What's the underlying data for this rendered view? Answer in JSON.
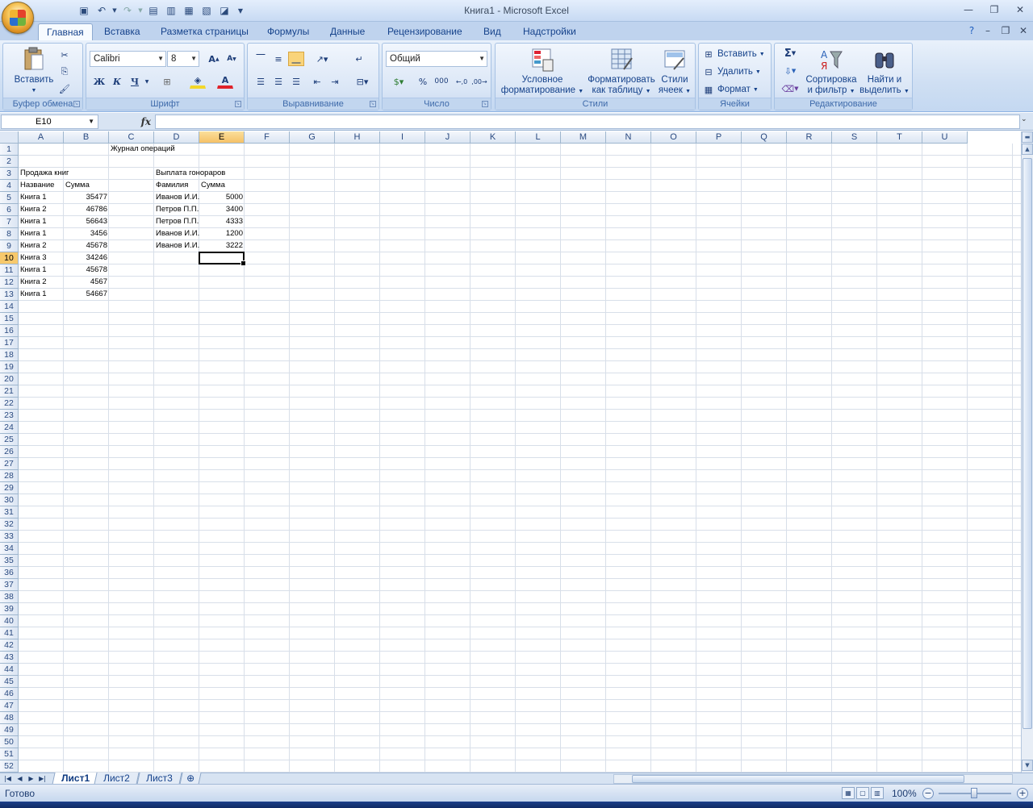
{
  "window": {
    "title": "Книга1 - Microsoft Excel"
  },
  "ribbon": {
    "tabs": [
      "Главная",
      "Вставка",
      "Разметка страницы",
      "Формулы",
      "Данные",
      "Рецензирование",
      "Вид",
      "Надстройки"
    ],
    "active_tab": "Главная",
    "groups": {
      "clipboard": {
        "label": "Буфер обмена",
        "paste": "Вставить"
      },
      "font": {
        "label": "Шрифт",
        "font_name": "Calibri",
        "font_size": "8",
        "bold": "Ж",
        "italic": "К",
        "underline": "Ч"
      },
      "alignment": {
        "label": "Выравнивание"
      },
      "number": {
        "label": "Число",
        "format": "Общий",
        "percent": "%",
        "thousands": "000"
      },
      "styles": {
        "label": "Стили",
        "conditional_1": "Условное",
        "conditional_2": "форматирование",
        "as_table_1": "Форматировать",
        "as_table_2": "как таблицу",
        "cell_styles_1": "Стили",
        "cell_styles_2": "ячеек"
      },
      "cells": {
        "label": "Ячейки",
        "insert": "Вставить",
        "delete": "Удалить",
        "format": "Формат"
      },
      "editing": {
        "label": "Редактирование",
        "sum": "Σ",
        "sort_1": "Сортировка",
        "sort_2": "и фильтр",
        "find_1": "Найти и",
        "find_2": "выделить"
      }
    }
  },
  "formula_bar": {
    "name_box": "E10",
    "fx": "fx",
    "formula": ""
  },
  "sheet": {
    "columns": [
      "A",
      "B",
      "C",
      "D",
      "E",
      "F",
      "G",
      "H",
      "I",
      "J",
      "K",
      "L",
      "M",
      "N",
      "O",
      "P",
      "Q",
      "R",
      "S",
      "T",
      "U"
    ],
    "selected_column": "E",
    "selected_row": 10,
    "rows": 52,
    "cells": [
      {
        "ref": "C1",
        "value": "Журнал операций"
      },
      {
        "ref": "A3",
        "value": "Продажа книг"
      },
      {
        "ref": "D3",
        "value": "Выплата гонораров"
      },
      {
        "ref": "A4",
        "value": "Название"
      },
      {
        "ref": "B4",
        "value": "Сумма"
      },
      {
        "ref": "D4",
        "value": "Фамилия"
      },
      {
        "ref": "E4",
        "value": "Сумма"
      },
      {
        "ref": "A5",
        "value": "Книга 1"
      },
      {
        "ref": "B5",
        "value": "35477"
      },
      {
        "ref": "D5",
        "value": "Иванов И.И."
      },
      {
        "ref": "E5",
        "value": "5000"
      },
      {
        "ref": "A6",
        "value": "Книга 2"
      },
      {
        "ref": "B6",
        "value": "46786"
      },
      {
        "ref": "D6",
        "value": "Петров П.П."
      },
      {
        "ref": "E6",
        "value": "3400"
      },
      {
        "ref": "A7",
        "value": "Книга 1"
      },
      {
        "ref": "B7",
        "value": "56643"
      },
      {
        "ref": "D7",
        "value": "Петров П.П."
      },
      {
        "ref": "E7",
        "value": "4333"
      },
      {
        "ref": "A8",
        "value": "Книга 1"
      },
      {
        "ref": "B8",
        "value": "3456"
      },
      {
        "ref": "D8",
        "value": "Иванов И.И."
      },
      {
        "ref": "E8",
        "value": "1200"
      },
      {
        "ref": "A9",
        "value": "Книга 2"
      },
      {
        "ref": "B9",
        "value": "45678"
      },
      {
        "ref": "D9",
        "value": "Иванов И.И."
      },
      {
        "ref": "E9",
        "value": "3222"
      },
      {
        "ref": "A10",
        "value": "Книга 3"
      },
      {
        "ref": "B10",
        "value": "34246"
      },
      {
        "ref": "A11",
        "value": "Книга 1"
      },
      {
        "ref": "B11",
        "value": "45678"
      },
      {
        "ref": "A12",
        "value": "Книга 2"
      },
      {
        "ref": "B12",
        "value": "4567"
      },
      {
        "ref": "A13",
        "value": "Книга 1"
      },
      {
        "ref": "B13",
        "value": "54667"
      }
    ],
    "tabs": [
      "Лист1",
      "Лист2",
      "Лист3"
    ],
    "active_tab": "Лист1"
  },
  "status": {
    "text": "Готово",
    "zoom": "100%"
  }
}
